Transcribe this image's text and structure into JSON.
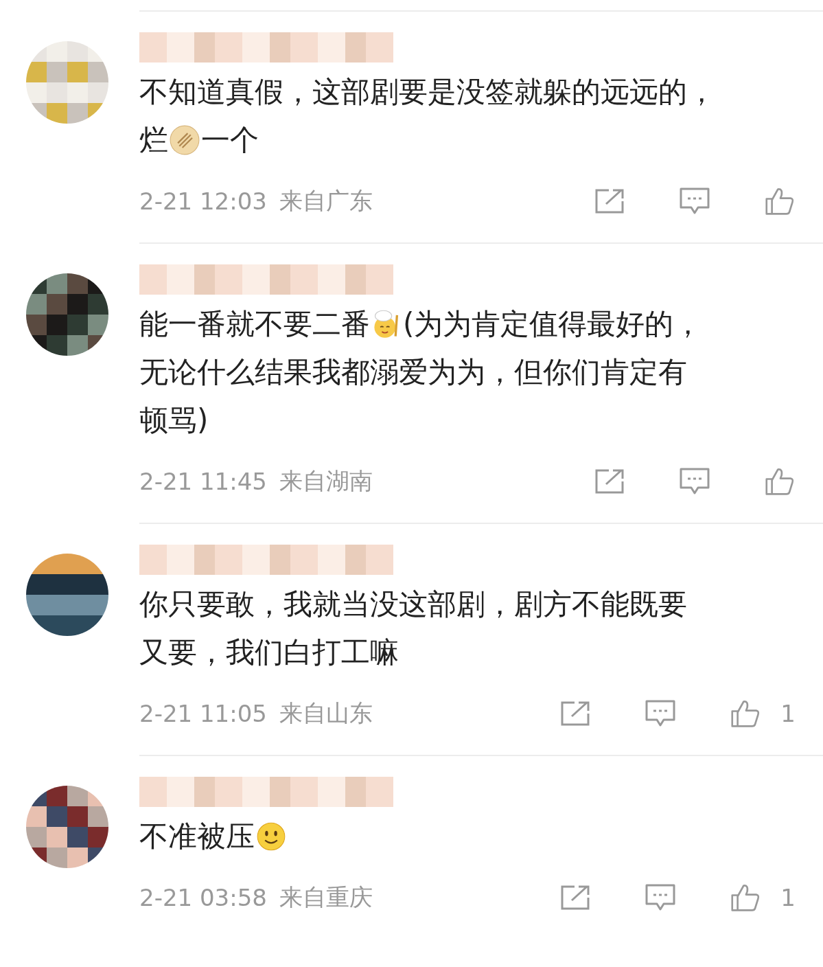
{
  "comments": [
    {
      "author": {
        "redacted": true
      },
      "lines": [
        [
          {
            "kind": "text",
            "text": "不知道真假，这部剧要是没签就躲的远远的，"
          }
        ],
        [
          {
            "kind": "text",
            "text": "烂"
          },
          {
            "kind": "pancake"
          },
          {
            "kind": "text",
            "text": "一个"
          }
        ]
      ],
      "time": "2-21 12:03",
      "location": "来自广东"
    },
    {
      "author": {
        "redacted": true
      },
      "lines": [
        [
          {
            "kind": "text",
            "text": "能一番就不要二番"
          },
          {
            "kind": "chef-face"
          },
          {
            "kind": "text",
            "text": "(为为肯定值得最好的，"
          }
        ],
        [
          {
            "kind": "text",
            "text": "无论什么结果我都溺爱为为，但你们肯定有"
          }
        ],
        [
          {
            "kind": "text",
            "text": "顿骂)"
          }
        ]
      ],
      "time": "2-21 11:45",
      "location": "来自湖南"
    },
    {
      "author": {
        "redacted": true
      },
      "lines": [
        [
          {
            "kind": "text",
            "text": "你只要敢，我就当没这部剧，剧方不能既要"
          }
        ],
        [
          {
            "kind": "text",
            "text": "又要，我们白打工嘛"
          }
        ]
      ],
      "time": "2-21 11:05",
      "location": "来自山东",
      "likes": "1"
    },
    {
      "author": {
        "redacted": true
      },
      "lines": [
        [
          {
            "kind": "text",
            "text": "不准被压"
          },
          {
            "kind": "smile-face"
          }
        ]
      ],
      "time": "2-21 03:58",
      "location": "来自重庆",
      "likes": "1"
    }
  ]
}
